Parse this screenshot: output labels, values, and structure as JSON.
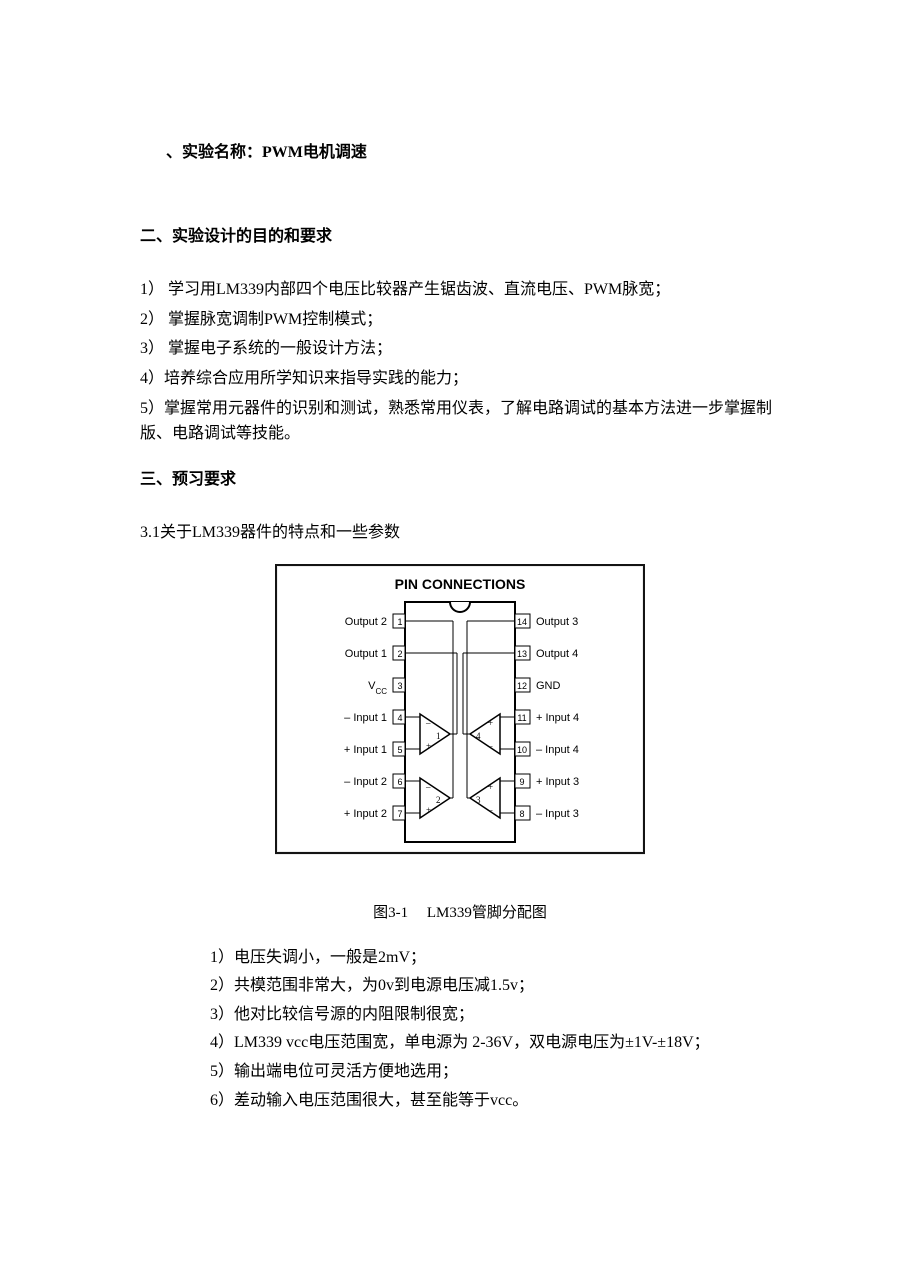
{
  "section1": {
    "title_prefix": "、实验名称：",
    "title_main": "PWM电机调速"
  },
  "section2": {
    "heading": "二、实验设计的目的和要求",
    "items": [
      "1）  学习用LM339内部四个电压比较器产生锯齿波、直流电压、PWM脉宽；",
      "2）  掌握脉宽调制PWM控制模式；",
      "3）  掌握电子系统的一般设计方法；",
      "4）培养综合应用所学知识来指导实践的能力；",
      "5）掌握常用元器件的识别和测试，熟悉常用仪表，了解电路调试的基本方法进一步掌握制版、电路调试等技能。"
    ]
  },
  "section3": {
    "heading": "三、预习要求",
    "subheading": "3.1关于LM339器件的特点和一些参数",
    "figure": {
      "caption_prefix": "图3-1",
      "caption_main": "LM339管脚分配图",
      "title": "PIN CONNECTIONS",
      "left_labels": [
        "Output 2",
        "Output 1",
        "V_CC",
        "– Input 1",
        "+ Input 1",
        "– Input 2",
        "+ Input 2"
      ],
      "left_pins": [
        "1",
        "2",
        "3",
        "4",
        "5",
        "6",
        "7"
      ],
      "right_pins": [
        "14",
        "13",
        "12",
        "11",
        "10",
        "9",
        "8"
      ],
      "right_labels": [
        "Output 3",
        "Output 4",
        "GND",
        "+ Input 4",
        "– Input 4",
        "+ Input 3",
        "– Input 3"
      ]
    },
    "features": [
      "1）电压失调小，一般是2mV；",
      "2）共模范围非常大，为0v到电源电压减1.5v；",
      "3）他对比较信号源的内阻限制很宽；",
      "4）LM339 vcc电压范围宽，单电源为 2-36V，双电源电压为±1V-±18V；",
      "5）输出端电位可灵活方便地选用；",
      "6）差动输入电压范围很大，甚至能等于vcc。"
    ]
  }
}
